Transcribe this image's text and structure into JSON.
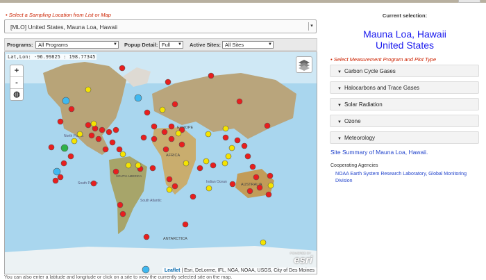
{
  "header": {
    "select_label": "• Select a Sampling Location from List or Map",
    "location_value": "[MLO] United States, Mauna Loa, Hawaii"
  },
  "toolbar": {
    "programs_label": "Programs:",
    "programs_value": "All Programs",
    "popup_label": "Popup Detail:",
    "popup_value": "Full",
    "active_label": "Active Sites:",
    "active_value": "All Sites"
  },
  "map": {
    "coordinates": "Lat,Lon: -96.99825 : 198.77345",
    "zoom_in": "+",
    "zoom_out": "-",
    "attribution_link": "Leaflet",
    "attribution_text": " | Esri, DeLorme, IFL, NGA, NOAA, USGS, City of Des Moines",
    "esri_logo": "esri",
    "powered_by": "POWERED BY",
    "labels": {
      "europe": "EUROPE",
      "africa": "AFRICA",
      "australia": "AUSTRALIA",
      "antarctica": "ANTARCTICA",
      "north_pacific": "North Pacific",
      "south_pacific": "South Pacific",
      "south_atlantic": "South Atlantic",
      "indian_ocean": "Indian Ocean",
      "south_america": "SOUTH AMERICA"
    },
    "marker_colors": {
      "red": "#e81e1e",
      "yellow": "#f5e400",
      "blue": "#3fb8f0",
      "green": "#2db24a"
    }
  },
  "footer_note": "You can also enter a latitude and longitude or click on a site to view the currently selected site on the map.",
  "selection": {
    "label": "Current selection:",
    "site_line1": "Mauna Loa, Hawaii",
    "site_line2": "United States"
  },
  "programs": {
    "label": "• Select Measurement Program and Plot Type",
    "items": [
      "Carbon Cycle Gases",
      "Halocarbons and Trace Gases",
      "Solar Radiation",
      "Ozone",
      "Meteorology"
    ]
  },
  "summary_link": "Site Summary of Mauna Loa, Hawaii.",
  "cooperating": {
    "label": "Cooperating Agencies",
    "agency": "NOAA Earth System Research Laboratory, Global Monitoring Division"
  }
}
